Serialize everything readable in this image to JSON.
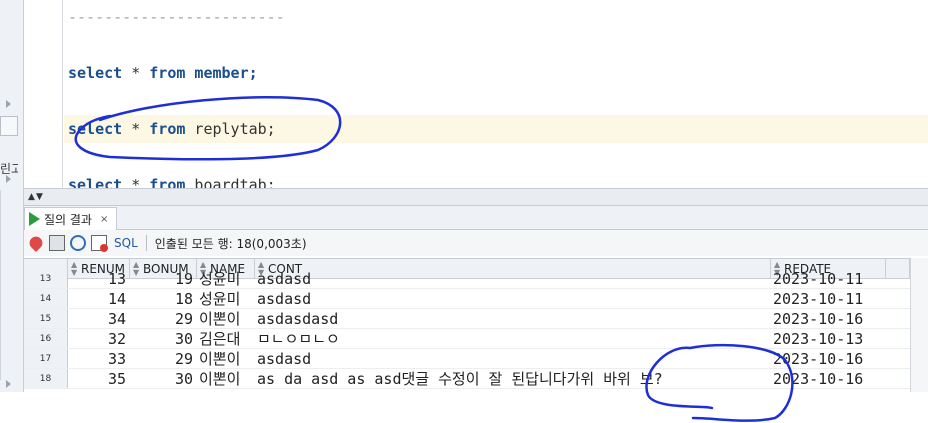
{
  "editor": {
    "lines": [
      {
        "kind": "dashes",
        "text": "------------------------"
      },
      {
        "kind": "sql",
        "keyword1": "select",
        "star": " * ",
        "keyword2": "from",
        "table": " member;"
      },
      {
        "kind": "sql",
        "keyword1": "select",
        "star": " * ",
        "keyword2": "from",
        "table": " replytab;"
      },
      {
        "kind": "sql",
        "keyword1": "select",
        "star": " * ",
        "keyword2": "from",
        "table": " boardtab;"
      }
    ]
  },
  "left_panel": {
    "clipped_text": "린고"
  },
  "result_tab": {
    "label": "질의 결과",
    "close": "×"
  },
  "toolbar": {
    "sql_label": "SQL",
    "status_text": "인출된 모든 행: 18(0,003초)",
    "icons": [
      "pin-icon",
      "print-icon",
      "refresh-icon",
      "export-icon"
    ]
  },
  "grid": {
    "columns": [
      "RENUM",
      "BONUM",
      "NAME",
      "CONT",
      "REDATE"
    ],
    "rows": [
      {
        "n": "13",
        "renum": "13",
        "bonum": "19",
        "name": "성윤미",
        "cont": "asdasd",
        "redate": "2023-10-11"
      },
      {
        "n": "14",
        "renum": "14",
        "bonum": "18",
        "name": "성윤미",
        "cont": "asdasd",
        "redate": "2023-10-11"
      },
      {
        "n": "15",
        "renum": "34",
        "bonum": "29",
        "name": "이뽄이",
        "cont": "asdasdasd",
        "redate": "2023-10-16"
      },
      {
        "n": "16",
        "renum": "32",
        "bonum": "30",
        "name": "김은대",
        "cont": "ㅁㄴㅇㅁㄴㅇ",
        "redate": "2023-10-13"
      },
      {
        "n": "17",
        "renum": "33",
        "bonum": "29",
        "name": "이뽄이",
        "cont": "asdasd",
        "redate": "2023-10-16"
      },
      {
        "n": "18",
        "renum": "35",
        "bonum": "30",
        "name": "이뽄이",
        "cont": "as da asd as asd댓글 수정이 잘 된답니다가위 바위 보?",
        "redate": "2023-10-16"
      }
    ]
  },
  "colors": {
    "keyword": "#1a4e8c",
    "annotation": "#1f2fd6",
    "run_icon": "#2c9b3c"
  }
}
